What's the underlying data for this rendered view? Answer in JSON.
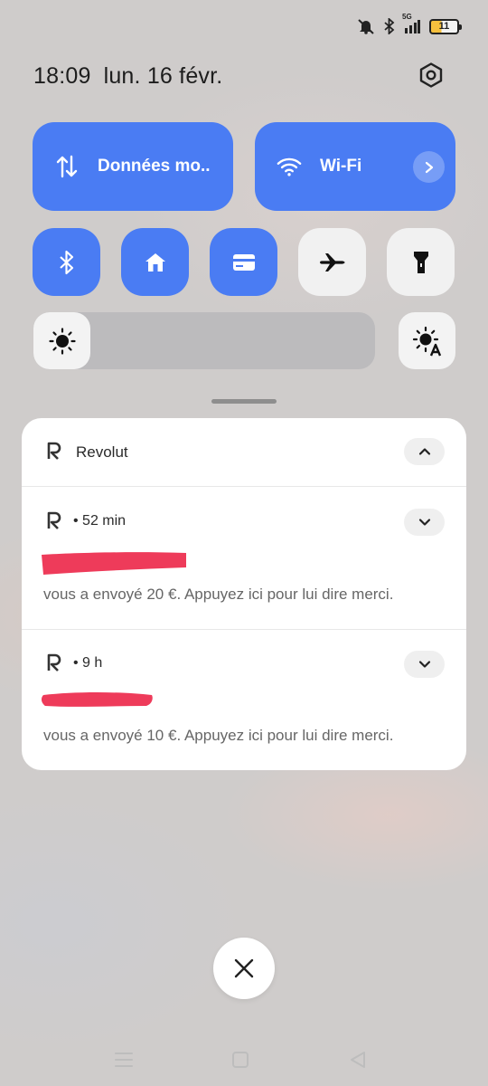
{
  "status_bar": {
    "network_label": "5G",
    "battery_level": "11",
    "battery_fill_percent": 40,
    "icons": [
      "mute-icon",
      "bluetooth-icon",
      "signal-icon",
      "battery-icon"
    ]
  },
  "header": {
    "time": "18:09",
    "date": "lun. 16 févr."
  },
  "quick_settings": {
    "accent_color": "#4a7cf3",
    "big_tiles": [
      {
        "label": "Données mo..",
        "icon": "mobile-data-icon",
        "active": true
      },
      {
        "label": "Wi-Fi",
        "icon": "wifi-icon",
        "active": true
      }
    ],
    "small_tiles": [
      {
        "icon": "bluetooth-icon",
        "active": true
      },
      {
        "icon": "home-icon",
        "active": true
      },
      {
        "icon": "card-icon",
        "active": true
      },
      {
        "icon": "airplane-icon",
        "active": false
      },
      {
        "icon": "flashlight-icon",
        "active": false
      }
    ],
    "brightness_level": 0
  },
  "notifications": {
    "app_name": "Revolut",
    "redaction_color": "#ee3b5a",
    "items": [
      {
        "meta": "• 52 min",
        "body": "vous a envoyé 20 €. Appuyez ici pour lui dire merci."
      },
      {
        "meta": "• 9 h",
        "body": "vous a envoyé 10 €. Appuyez ici pour lui dire merci."
      }
    ]
  },
  "nav_bar": {
    "buttons": [
      "menu-icon",
      "home-square-icon",
      "back-triangle-icon"
    ]
  }
}
